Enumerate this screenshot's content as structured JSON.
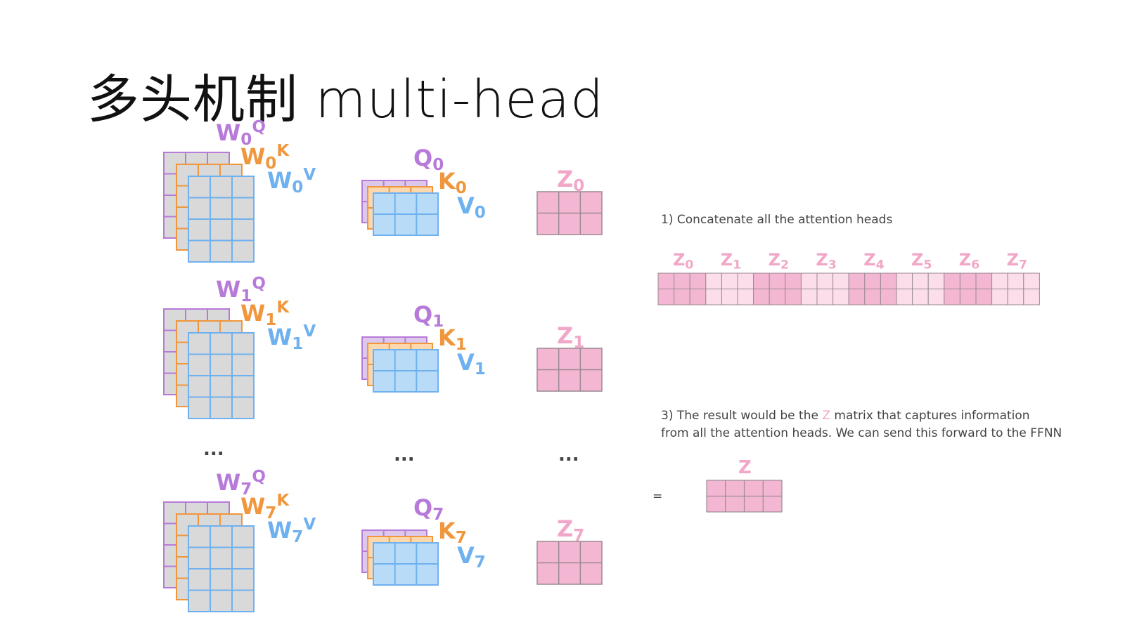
{
  "title": "多头机制 multi-head",
  "colors": {
    "query_purple": "#b87ad9",
    "query_fill": "#dcc8ea",
    "key_orange": "#f0963c",
    "key_fill": "#fbd8ae",
    "value_blue": "#6fb1ef",
    "value_fill": "#b8dcf7",
    "weight_fill": "#d9d9d9",
    "z_pink": "#f2a7c8",
    "z_fill": "#f4b7d3",
    "z_fill_light": "#fbdeea",
    "ellipsis": "#444444"
  },
  "heads": [
    {
      "weights": {
        "w": "W",
        "q_sub": "0",
        "q_sup": "Q",
        "k_sub": "0",
        "k_sup": "K",
        "v_sub": "0",
        "v_sup": "V"
      },
      "qkv": {
        "q": "Q",
        "q_sub": "0",
        "k": "K",
        "k_sub": "0",
        "v": "V",
        "v_sub": "0"
      },
      "z": {
        "z": "Z",
        "z_sub": "0"
      }
    },
    {
      "weights": {
        "w": "W",
        "q_sub": "1",
        "q_sup": "Q",
        "k_sub": "1",
        "k_sup": "K",
        "v_sub": "1",
        "v_sup": "V"
      },
      "qkv": {
        "q": "Q",
        "q_sub": "1",
        "k": "K",
        "k_sub": "1",
        "v": "V",
        "v_sub": "1"
      },
      "z": {
        "z": "Z",
        "z_sub": "1"
      }
    },
    {
      "weights": {
        "w": "W",
        "q_sub": "7",
        "q_sup": "Q",
        "k_sub": "7",
        "k_sup": "K",
        "v_sub": "7",
        "v_sup": "V"
      },
      "qkv": {
        "q": "Q",
        "q_sub": "7",
        "k": "K",
        "k_sub": "7",
        "v": "V",
        "v_sub": "7"
      },
      "z": {
        "z": "Z",
        "z_sub": "7"
      }
    }
  ],
  "ellipsis": "...",
  "concat": {
    "caption": "1) Concatenate all the attention heads",
    "labels": [
      {
        "z": "Z",
        "sub": "0"
      },
      {
        "z": "Z",
        "sub": "1"
      },
      {
        "z": "Z",
        "sub": "2"
      },
      {
        "z": "Z",
        "sub": "3"
      },
      {
        "z": "Z",
        "sub": "4"
      },
      {
        "z": "Z",
        "sub": "5"
      },
      {
        "z": "Z",
        "sub": "6"
      },
      {
        "z": "Z",
        "sub": "7"
      }
    ]
  },
  "result": {
    "caption_part1": "3) The result would be the ",
    "caption_z": "Z",
    "caption_part2": " matrix that captures information",
    "caption_line2": "from all the attention heads. We can send this forward to the FFNN",
    "equals": "=",
    "z_label": "Z"
  }
}
